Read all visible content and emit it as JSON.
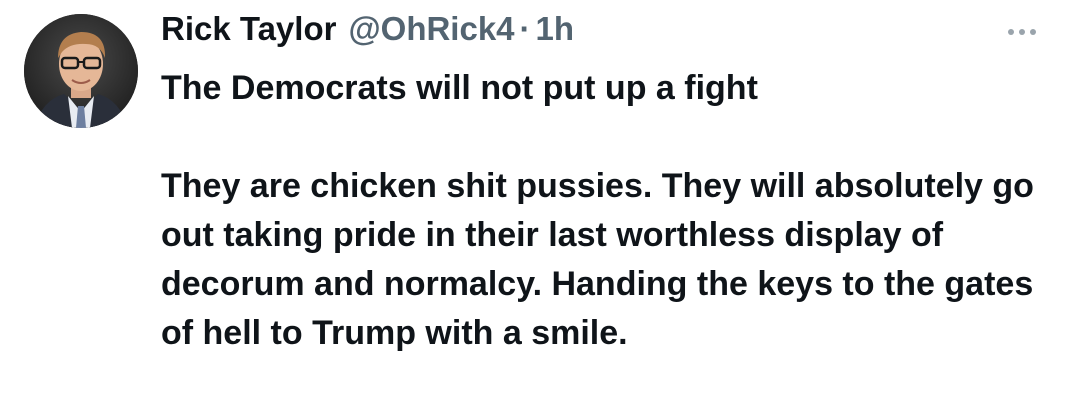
{
  "tweet": {
    "author_name": "Rick Taylor",
    "handle": "@OhRick4",
    "separator": "·",
    "time": "1h",
    "more_icon": "more-horizontal-icon",
    "paragraphs": [
      "The Democrats will not put up a fight",
      "They are chicken shit pussies. They will absolutely go out taking pride in their last worthless display of decorum and normalcy. Handing the keys to the gates of hell to Trump with a smile."
    ]
  }
}
